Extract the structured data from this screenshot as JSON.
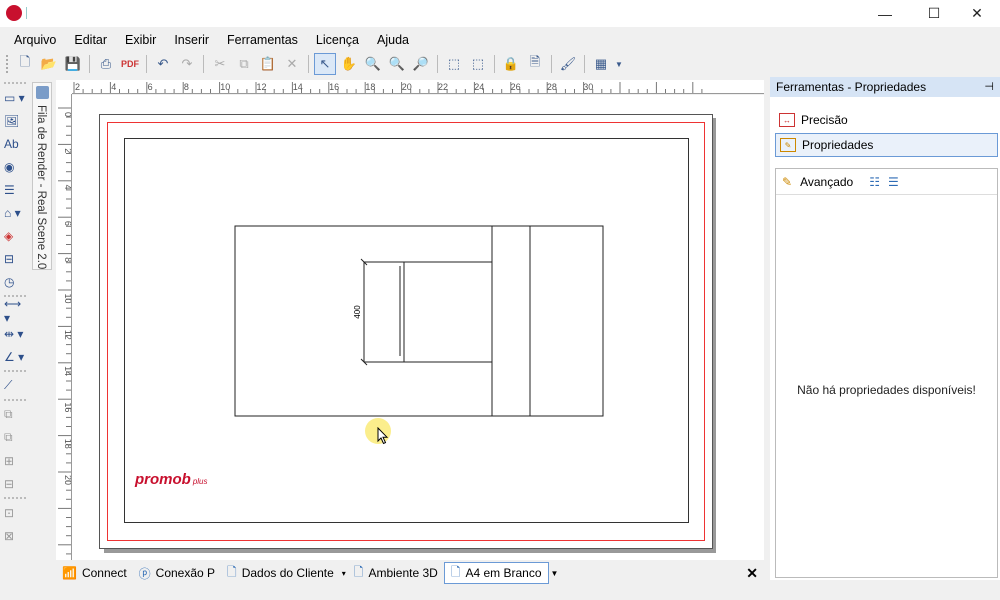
{
  "window": {
    "minimize": "—",
    "maximize": "☐",
    "close": "✕"
  },
  "menu": [
    "Arquivo",
    "Editar",
    "Exibir",
    "Inserir",
    "Ferramentas",
    "Licença",
    "Ajuda"
  ],
  "ruler": {
    "top": [
      "2",
      "4",
      "6",
      "8",
      "10",
      "12",
      "14",
      "16",
      "18",
      "20",
      "22",
      "24",
      "26",
      "28",
      "30"
    ],
    "left": [
      "0",
      "2",
      "4",
      "6",
      "8",
      "10",
      "12",
      "14",
      "16",
      "18",
      "20"
    ]
  },
  "render_queue_tab": "Fila de Render - Real Scene 2.0",
  "drawing": {
    "dimension_label": "400",
    "logo": "promob",
    "logo_suffix": "plus"
  },
  "document_tabs": [
    "Connect",
    "Conexão P",
    "Dados do Cliente",
    "Ambiente 3D",
    "A4 em Branco"
  ],
  "document_tabs_close": "✕",
  "panel": {
    "title": "Ferramentas - Propriedades",
    "pin": "📌",
    "nav": [
      "Precisão",
      "Propriedades"
    ],
    "advanced": "Avançado",
    "empty_message": "Não há propriedades disponíveis!"
  },
  "colors": {
    "accent_border": "#6b9ad6",
    "margin_red": "#ee3333",
    "logo_red": "#c8102e",
    "panel_header": "#d6e4f5"
  }
}
